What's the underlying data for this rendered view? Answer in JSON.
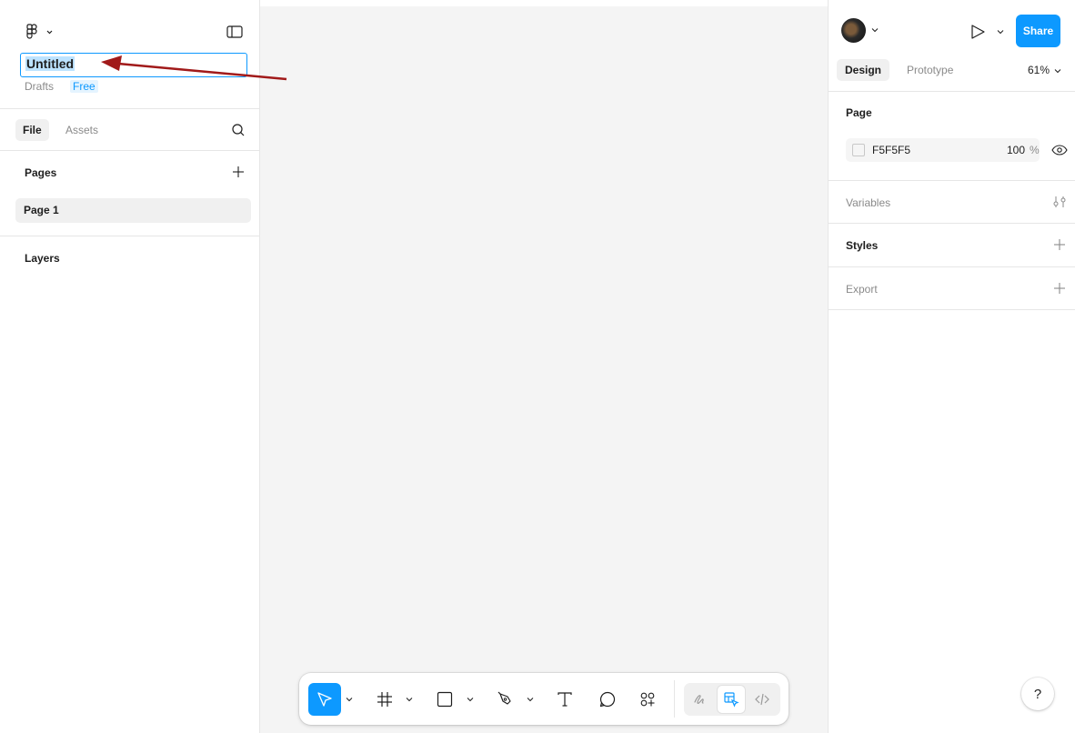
{
  "left_panel": {
    "file_name": "Untitled",
    "location": "Drafts",
    "plan_badge": "Free",
    "tabs": [
      "File",
      "Assets"
    ],
    "pages_title": "Pages",
    "pages": [
      "Page 1"
    ],
    "layers_title": "Layers"
  },
  "right_panel": {
    "share_label": "Share",
    "tabs": [
      "Design",
      "Prototype"
    ],
    "zoom": "61%",
    "page_section": "Page",
    "fill_hex": "F5F5F5",
    "fill_opacity": "100",
    "fill_opacity_unit": "%",
    "variables_label": "Variables",
    "styles_label": "Styles",
    "export_label": "Export"
  },
  "toolbar": {
    "tools": [
      "move-icon",
      "frame-icon",
      "rectangle-icon",
      "pen-icon",
      "text-icon",
      "comment-icon",
      "actions-icon"
    ],
    "dev_tools": [
      "draw-icon",
      "design-mode-icon",
      "dev-mode-icon"
    ]
  },
  "help_label": "?",
  "colors": {
    "accent": "#0d99ff",
    "canvas": "#f4f4f4",
    "annotation_arrow": "#a11a1a"
  }
}
